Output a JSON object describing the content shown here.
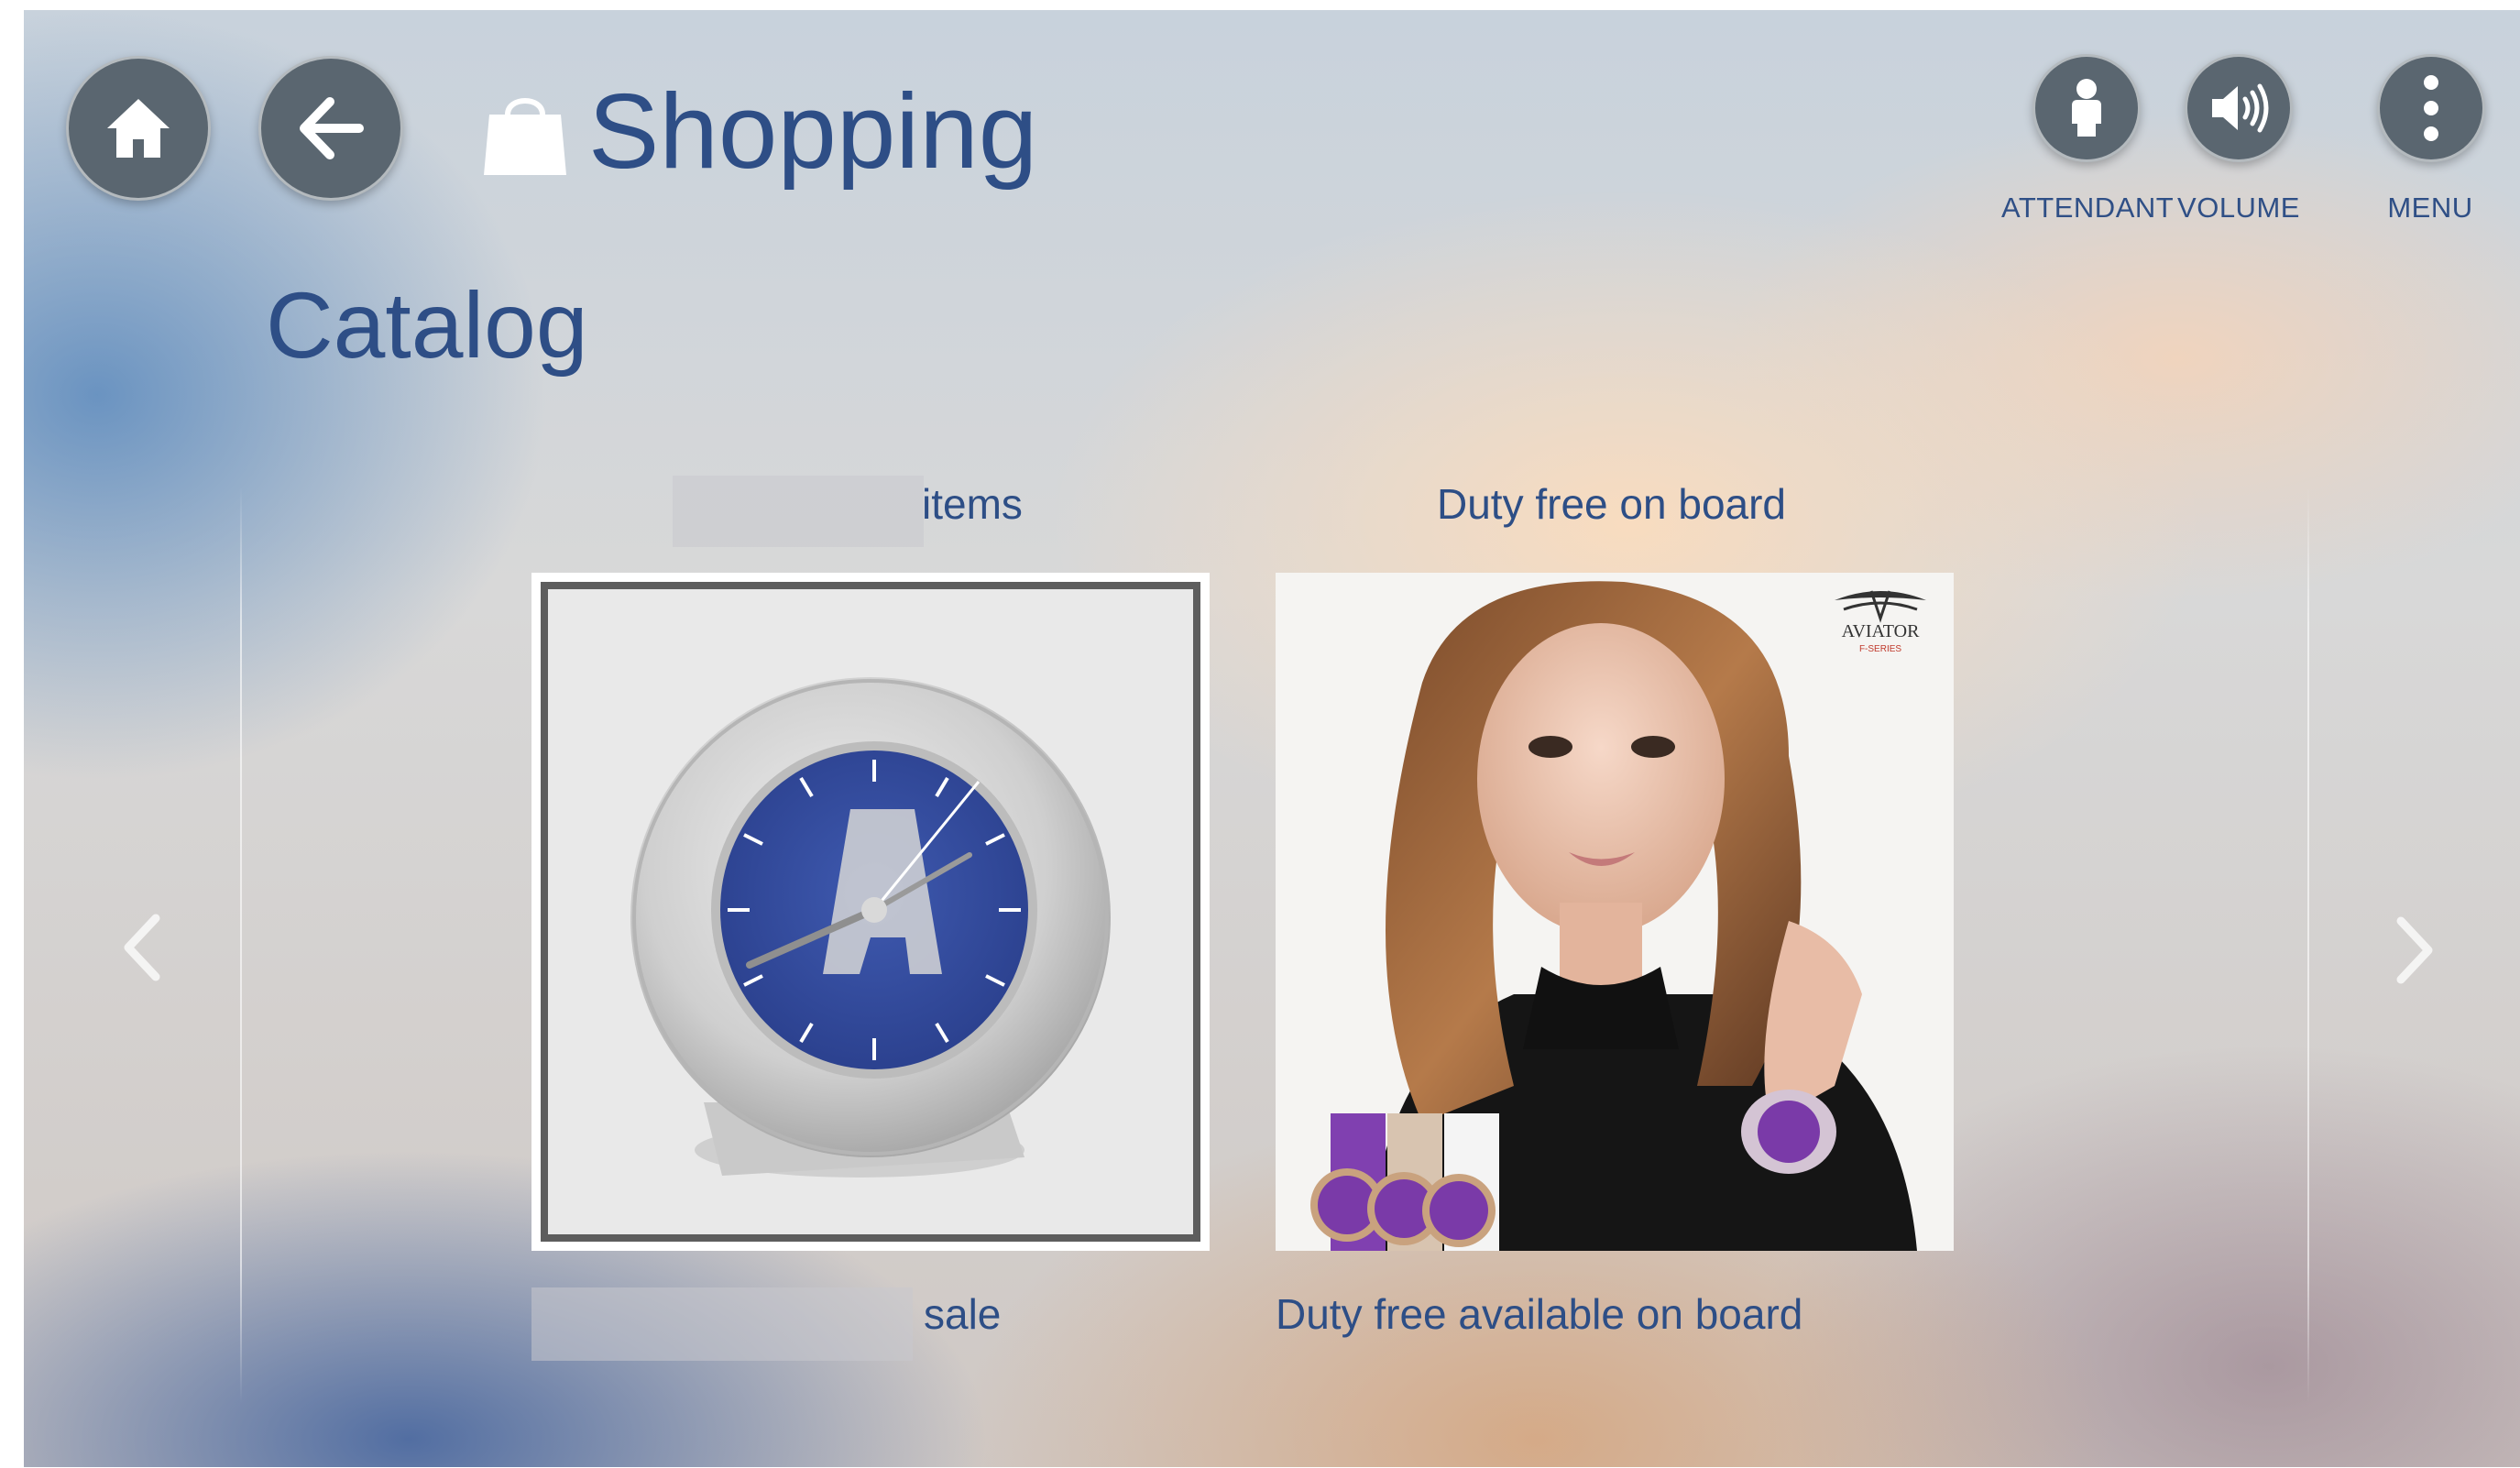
{
  "header": {
    "home_icon": "home-icon",
    "back_icon": "back-arrow-icon",
    "section_icon": "shopping-bag-icon",
    "section_title": "Shopping",
    "actions": [
      {
        "label": "ATTENDANT",
        "icon": "person-icon"
      },
      {
        "label": "VOLUME",
        "icon": "speaker-icon"
      },
      {
        "label": "MENU",
        "icon": "vertical-dots-icon"
      }
    ]
  },
  "page_title": "Catalog",
  "carousel": {
    "prev_icon": "chevron-left-icon",
    "next_icon": "chevron-right-icon",
    "items": [
      {
        "heading": "items",
        "caption": "sale",
        "image": "blue-dial-alarm-clock",
        "selected": true
      },
      {
        "heading": "Duty free on board",
        "caption": "Duty free available on board",
        "image": "aviator-watches-advert",
        "brand": "AVIATOR",
        "brand_sub": "F-SERIES",
        "selected": false
      }
    ]
  },
  "colors": {
    "accent_text": "#2d4e86",
    "button_fill": "#5a6670"
  }
}
